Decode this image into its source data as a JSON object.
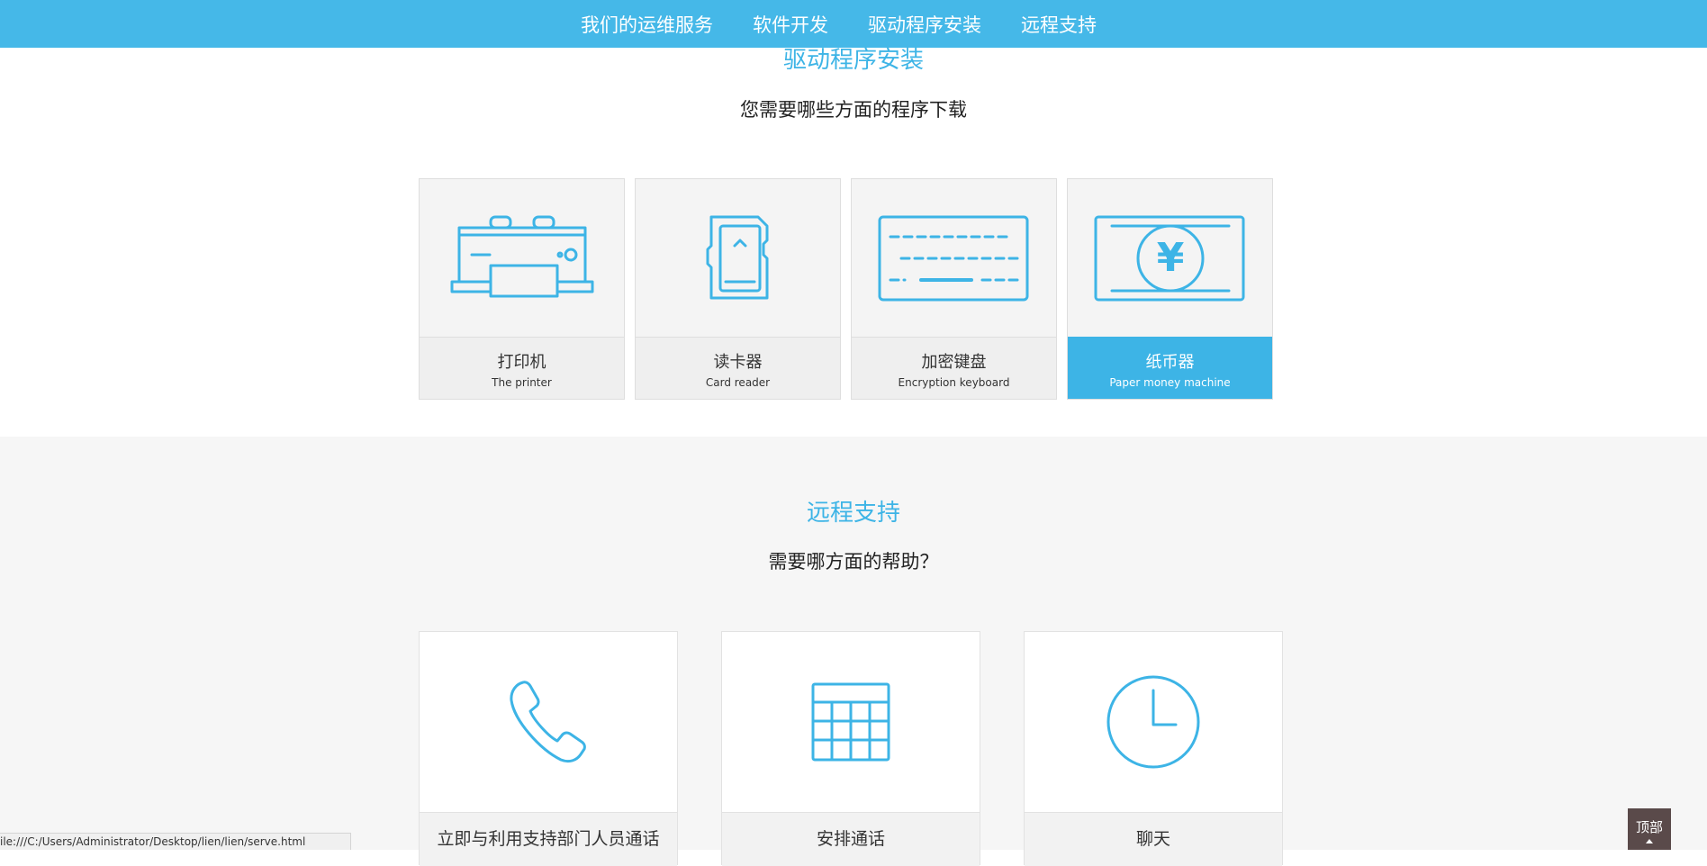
{
  "nav": {
    "items": [
      {
        "label": "我们的运维服务"
      },
      {
        "label": "软件开发"
      },
      {
        "label": "驱动程序安装"
      },
      {
        "label": "远程支持"
      }
    ]
  },
  "drivers": {
    "title": "驱动程序安装",
    "subtitle": "您需要哪些方面的程序下载",
    "cards": [
      {
        "cn": "打印机",
        "en": "The printer",
        "icon": "printer-icon"
      },
      {
        "cn": "读卡器",
        "en": "Card reader",
        "icon": "card-reader-icon"
      },
      {
        "cn": "加密键盘",
        "en": "Encryption keyboard",
        "icon": "keyboard-icon"
      },
      {
        "cn": "纸币器",
        "en": "Paper money machine",
        "icon": "banknote-icon",
        "active": true
      }
    ]
  },
  "remote": {
    "title": "远程支持",
    "subtitle": "需要哪方面的帮助？",
    "cards": [
      {
        "label": "立即与利用支持部门人员通话",
        "icon": "phone-icon"
      },
      {
        "label": "安排通话",
        "icon": "calendar-icon"
      },
      {
        "label": "聊天",
        "icon": "clock-icon"
      }
    ]
  },
  "status_bar": {
    "url": "ile:///C:/Users/Administrator/Desktop/lien/lien/serve.html"
  },
  "top_button": {
    "label": "顶部"
  },
  "colors": {
    "accent": "#3db4e6",
    "navbar": "#45b8e8",
    "top_button": "#5a4a4a"
  }
}
